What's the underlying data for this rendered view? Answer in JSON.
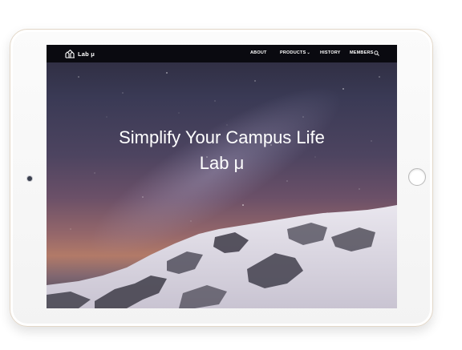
{
  "site": {
    "logo_text": "Lab μ",
    "logo_icon": "bird-logo-icon"
  },
  "nav": {
    "items": [
      {
        "label": "ABOUT",
        "has_dropdown": false
      },
      {
        "label": "PRODUCTS",
        "has_dropdown": true
      },
      {
        "label": "HISTORY",
        "has_dropdown": false
      },
      {
        "label": "MEMBERS",
        "has_dropdown": false
      }
    ],
    "search_icon": "search-icon",
    "dropdown_glyph": "⌄"
  },
  "hero": {
    "headline": "Simplify Your Campus Life",
    "subheadline": "Lab μ"
  },
  "colors": {
    "navbar": "#08080c",
    "device_frame": "#f3f3f3",
    "device_trim": "#e3d7c8",
    "text": "#ffffff"
  }
}
